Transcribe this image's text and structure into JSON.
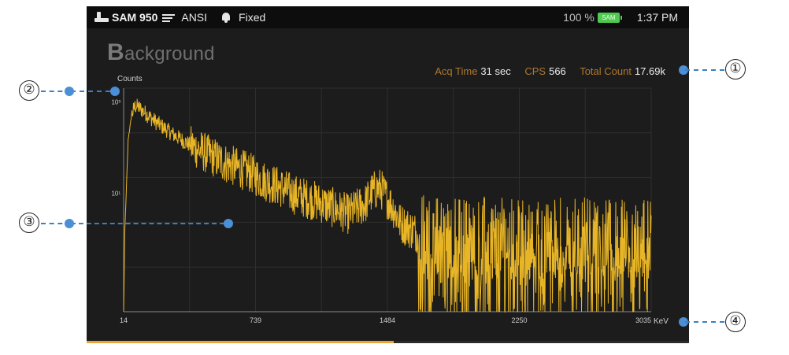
{
  "status_bar": {
    "device_name": "SAM 950",
    "standard": "ANSI",
    "mode": "Fixed",
    "battery_percent": "100 %",
    "battery_label": "SAM",
    "time": "1:37 PM"
  },
  "screen": {
    "title_initial": "B",
    "title_rest": "ackground"
  },
  "stats": {
    "acq_time_label": "Acq Time",
    "acq_time_value": "31 sec",
    "cps_label": "CPS",
    "cps_value": "566",
    "total_count_label": "Total Count",
    "total_count_value": "17.69k"
  },
  "progress": {
    "fraction": 0.51
  },
  "colors": {
    "spectrum": "#e8b526",
    "accent_label": "#b0782d",
    "callout_blue": "#3d7fc1"
  },
  "chart_data": {
    "type": "line",
    "ylabel": "Counts",
    "xlabel": "KeV",
    "y_scale": "log",
    "x_ticks": [
      "14",
      "739",
      "1484",
      "2250",
      "3035"
    ],
    "y_ticks": [
      "10³",
      "10¹"
    ],
    "xlim": [
      14,
      3035
    ],
    "grid": true,
    "series": [
      {
        "x": [
          14,
          20,
          40,
          60,
          80,
          100,
          150,
          200,
          300,
          400,
          500,
          600,
          700,
          739,
          800,
          900,
          1000,
          1100,
          1200,
          1300,
          1400,
          1440,
          1484,
          1520,
          1560,
          1600,
          1700,
          1800,
          2000,
          2250,
          2500,
          2750,
          2900,
          3035
        ],
        "y": [
          0.02,
          1.2,
          150,
          520,
          820,
          760,
          520,
          360,
          190,
          110,
          70,
          45,
          32,
          28,
          20,
          14,
          9,
          7,
          5,
          3.5,
          6,
          11,
          13,
          8,
          4.5,
          2.2,
          1.3,
          1.1,
          1.05,
          1.0,
          1.0,
          1.05,
          1.0,
          1.0
        ]
      }
    ]
  },
  "callouts": [
    "①",
    "②",
    "③",
    "④"
  ]
}
